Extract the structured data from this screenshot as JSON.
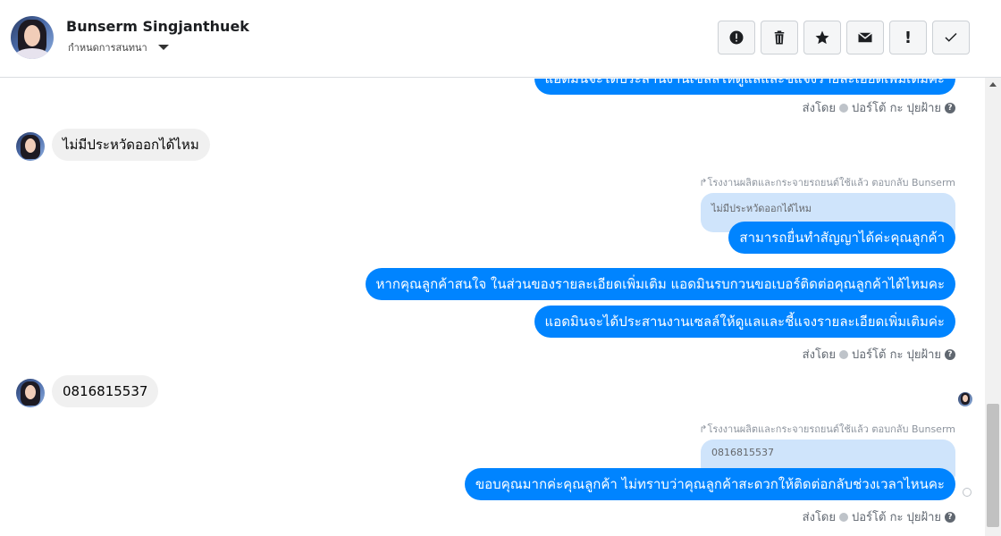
{
  "header": {
    "contact_name": "Bunserm Singjanthuek",
    "subtitle": "กำหนดการสนทนา",
    "toolbar": [
      {
        "name": "report-icon"
      },
      {
        "name": "trash-icon"
      },
      {
        "name": "star-icon"
      },
      {
        "name": "mail-icon"
      },
      {
        "name": "exclamation-icon",
        "label": "!"
      },
      {
        "name": "checkmark-icon"
      }
    ]
  },
  "thread": {
    "top_partial_message": "แอดมินจะได้ประสานงานเซลล์ให้ดูแลและชี้แจงรายละเอียดเพิ่มเติมค่ะ",
    "sent_by_1": "ส่งโดย",
    "sender_name": "ปอร์โต้ กะ ปุยฝ้าย",
    "incoming_1": "ไม่มีประหวัดออกได้ไหม",
    "replied_label_1": "โรงงานผลิตและกระจายรถยนต์ใช้แล้ว ตอบกลับ Bunserm",
    "quote_1": "ไม่มีประหวัดออกได้ไหม",
    "outgoing_1": "สามารถยื่นทำสัญญาได้ค่ะคุณลูกค้า",
    "outgoing_2": "หากคุณลูกค้าสนใจ ในส่วนของรายละเอียดเพิ่มเติม แอดมินรบกวนขอเบอร์ติดต่อคุณลูกค้าได้ไหมคะ",
    "outgoing_3": "แอดมินจะได้ประสานงานเซลล์ให้ดูแลและชี้แจงรายละเอียดเพิ่มเติมค่ะ",
    "sent_by_2": "ส่งโดย",
    "incoming_2": "0816815537",
    "replied_label_2": "โรงงานผลิตและกระจายรถยนต์ใช้แล้ว ตอบกลับ Bunserm",
    "quote_2": "0816815537",
    "outgoing_4": "ขอบคุณมากค่ะคุณลูกค้า ไม่ทราบว่าคุณลูกค้าสะดวกให้ติดต่อกลับช่วงเวลาไหนคะ",
    "sent_by_3": "ส่งโดย"
  }
}
